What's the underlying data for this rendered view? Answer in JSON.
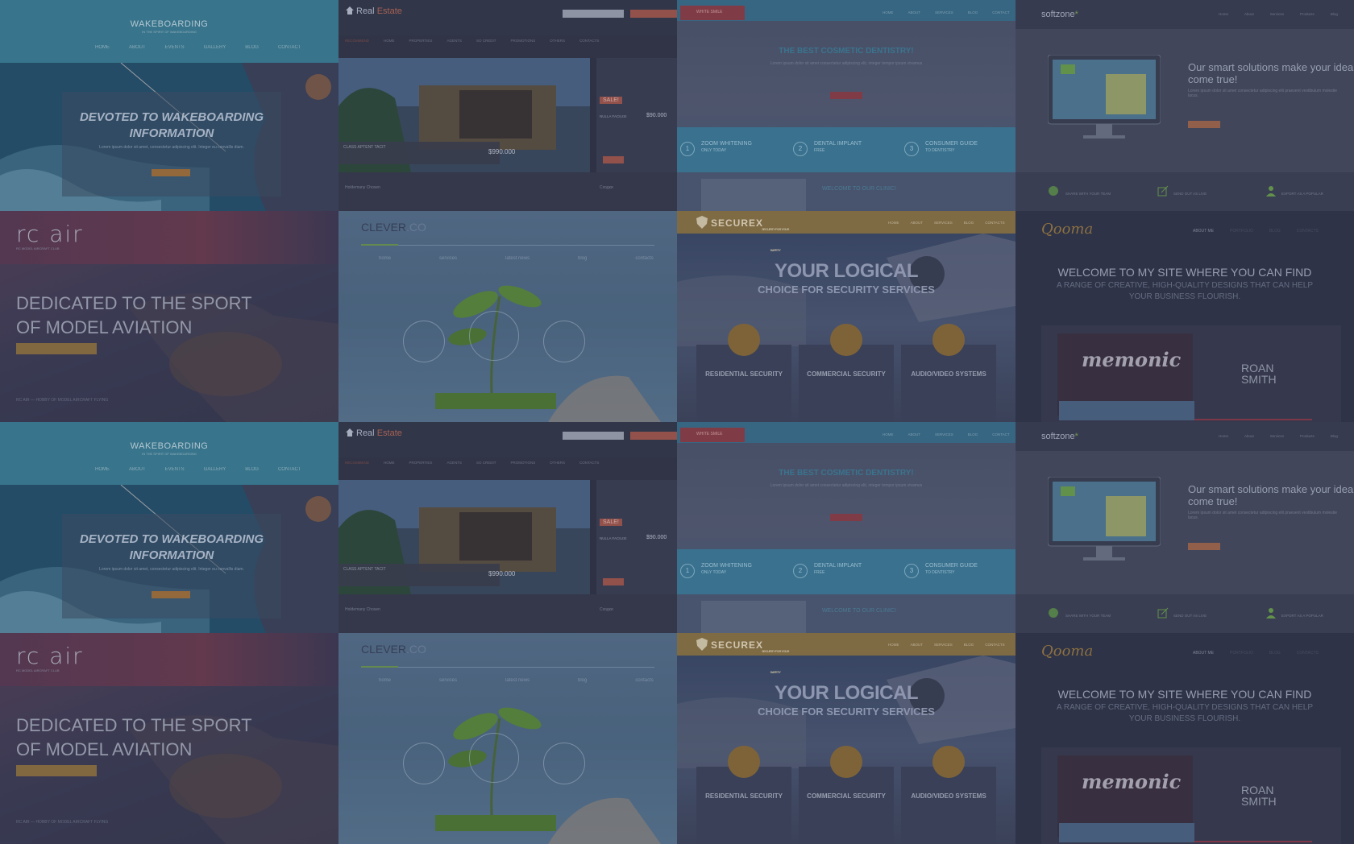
{
  "tiles": {
    "wake": {
      "logo": "WAKEBOARDING",
      "tagline": "IN THE SPIRIT OF WAKEBOARDING",
      "nav": [
        "HOME",
        "ABOUT",
        "EVENTS",
        "GALLERY",
        "BLOG",
        "CONTACT"
      ],
      "headline_1": "DEVOTED TO WAKEBOARDING",
      "headline_2": "INFORMATION",
      "sub": "Lorem ipsum dolor sit amet, consectetur adipiscing elit. Integer eu convallis diam.",
      "button": "READ MORE"
    },
    "real": {
      "logo_a": "Real",
      "logo_b": "Estate",
      "search_placeholder": "",
      "go": "Recommendation",
      "nav": [
        "RECOMMEND",
        "HOME",
        "PROPERTIES",
        "AGENTS",
        "SO CREDIT",
        "PROMOTIONS",
        "OTHERS",
        "CONTACTS"
      ],
      "caption": "CLASS APTENT TACIT",
      "price": "$990.000",
      "sale": "SALE!",
      "side_label": "NULLA FACILISI",
      "side_price": "$90.000",
      "label_left": "Holdemany Chosen",
      "label_right": "Сходки"
    },
    "dent": {
      "brand": "WHITE SMILE",
      "nav": [
        "HOME",
        "ABOUT",
        "SERVICES",
        "BLOG",
        "CONTACT"
      ],
      "headline": "THE BEST COSMETIC DENTISTRY!",
      "sub": "Lorem ipsum dolor sit amet consectetur adipiscing elit, integer tempor ipsum vivamus",
      "button": "READ MORE",
      "steps": [
        {
          "num": "1",
          "title": "ZOOM WHITENING",
          "sub": "ONLY TODAY"
        },
        {
          "num": "2",
          "title": "DENTAL IMPLANT",
          "sub": "FREE"
        },
        {
          "num": "3",
          "title": "CONSUMER GUIDE",
          "sub": "TO DENTISTRY"
        }
      ],
      "welcome": "WELCOME TO OUR CLINIC!"
    },
    "soft": {
      "logo": "softzone",
      "nav": [
        "Home",
        "About",
        "Services",
        "Products",
        "Blog"
      ],
      "headline": "Our smart solutions make your idea come true!",
      "sub": "Lorem ipsum dolor sit amet consectetur adipiscing elit praesent vestibulum molestie lacus.",
      "button": "more info",
      "features": [
        "SHARE WITH YOUR TEAM",
        "SEND OUT AS LIVE",
        "EXPORT AS A POPULAR"
      ]
    },
    "rc": {
      "logo": "rc air",
      "tag": "RC MODEL AIRCRAFT CLUB",
      "headline_1": "DEDICATED TO THE SPORT",
      "headline_2": "OF MODEL AVIATION",
      "footer": "RC AIR — HOBBY OF MODEL AIRCRAFT FLYING"
    },
    "clever": {
      "logo_a": "CLEVER",
      "logo_b": ".CO",
      "nav": [
        "home",
        "services",
        "latest news",
        "blog",
        "contacts"
      ]
    },
    "sec": {
      "logo": "SECUREX",
      "tag": "SECURITY FOR YOUR SAFETY",
      "nav": [
        "HOME",
        "ABOUT",
        "SERVICES",
        "BLOG",
        "CONTACTS"
      ],
      "headline_1": "YOUR LOGICAL",
      "headline_2": "CHOICE FOR SECURITY SERVICES",
      "cards": [
        "RESIDENTIAL SECURITY",
        "COMMERCIAL SECURITY",
        "AUDIO/VIDEO SYSTEMS"
      ]
    },
    "qoo": {
      "logo": "Qooma",
      "nav": [
        "ABOUT ME",
        "PORTFOLIO",
        "BLOG",
        "CONTACTS"
      ],
      "headline": "WELCOME TO MY SITE WHERE YOU CAN FIND",
      "sub_1": "A RANGE OF CREATIVE, HIGH-QUALITY DESIGNS THAT CAN HELP",
      "sub_2": "YOUR BUSINESS FLOURISH.",
      "memonic": "memonic",
      "roan_1": "ROAN",
      "roan_2": "SMITH"
    }
  },
  "colors": {
    "background": "#2c3348",
    "wake_accent": "#3b7f94",
    "real_accent": "#a1574b",
    "dent_accent": "#3d7c98",
    "sec_accent": "#8a7443",
    "qoo_accent": "#9a7a40"
  }
}
